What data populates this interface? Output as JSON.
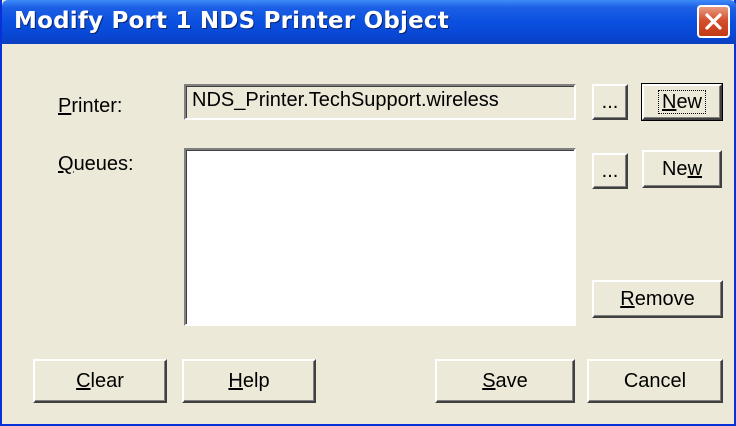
{
  "window": {
    "title": "Modify Port 1 NDS Printer Object",
    "close_glyph": "close-icon"
  },
  "printer": {
    "label_mnemonic": "P",
    "label_rest": "rinter:",
    "value": "NDS_Printer.TechSupport.wireless",
    "browse_label": "...",
    "new_label_mnemonic": "N",
    "new_label_rest": "ew"
  },
  "queues": {
    "label_mnemonic": "Q",
    "label_rest": "ueues:",
    "items": [],
    "browse_label": "...",
    "new_label_pre": "Ne",
    "new_label_mnemonic": "w",
    "remove_label_mnemonic": "R",
    "remove_label_rest": "emove"
  },
  "buttons": {
    "clear_mnemonic": "C",
    "clear_rest": "lear",
    "help_mnemonic": "H",
    "help_rest": "elp",
    "save_mnemonic": "S",
    "save_rest": "ave",
    "cancel_label": "Cancel"
  },
  "colors": {
    "titlebar": "#0a50e0",
    "dialog_face": "#ece9d8",
    "close_button": "#c23a16"
  }
}
